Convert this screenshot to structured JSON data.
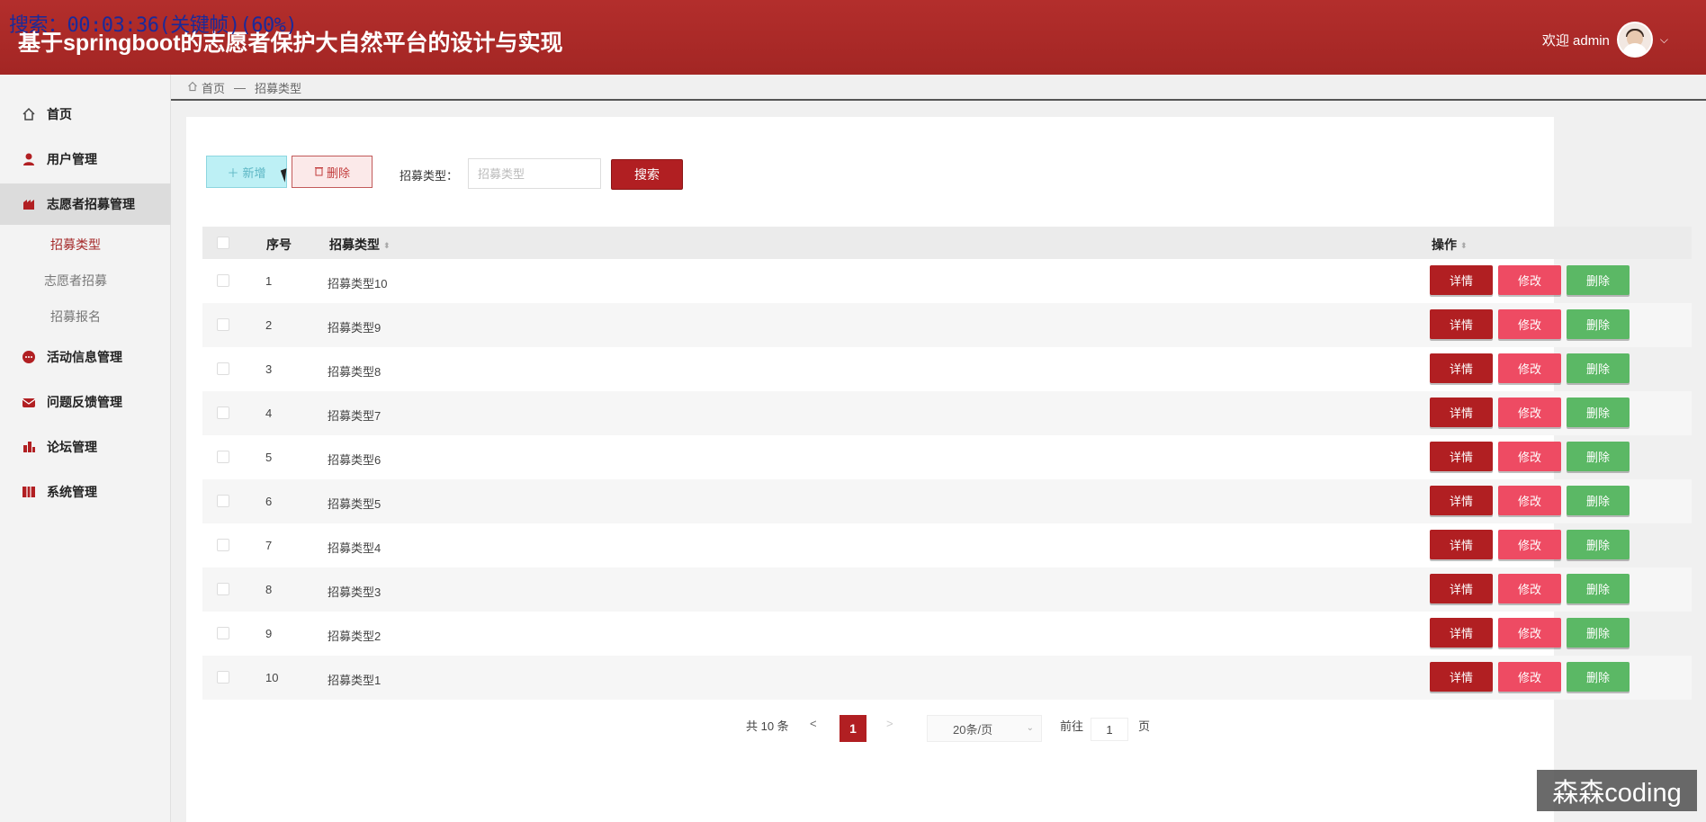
{
  "overlay": "搜索：00:03:36(关键帧)(60%)",
  "app": {
    "title": "基于springboot的志愿者保护大自然平台的设计与实现"
  },
  "user": {
    "welcome": "欢迎 admin",
    "chevron": "⌵"
  },
  "sidebar": {
    "items": [
      {
        "label": "首页",
        "icon": "home-icon"
      },
      {
        "label": "用户管理",
        "icon": "user-icon"
      },
      {
        "label": "志愿者招募管理",
        "icon": "recruit-icon"
      },
      {
        "label": "活动信息管理",
        "icon": "activity-icon"
      },
      {
        "label": "问题反馈管理",
        "icon": "feedback-icon"
      },
      {
        "label": "论坛管理",
        "icon": "forum-icon"
      },
      {
        "label": "系统管理",
        "icon": "system-icon"
      }
    ],
    "subitems": [
      {
        "label": "招募类型"
      },
      {
        "label": "志愿者招募"
      },
      {
        "label": "招募报名"
      }
    ]
  },
  "breadcrumb": {
    "home": "首页",
    "sep": "—",
    "current": "招募类型"
  },
  "toolbar": {
    "add_label": "新增",
    "delete_label": "删除",
    "search_label": "招募类型：",
    "search_placeholder": "招募类型",
    "search_button": "搜索"
  },
  "table": {
    "headers": {
      "index": "序号",
      "type": "招募类型",
      "actions": "操作"
    },
    "rows": [
      {
        "index": "1",
        "type": "招募类型10"
      },
      {
        "index": "2",
        "type": "招募类型9"
      },
      {
        "index": "3",
        "type": "招募类型8"
      },
      {
        "index": "4",
        "type": "招募类型7"
      },
      {
        "index": "5",
        "type": "招募类型6"
      },
      {
        "index": "6",
        "type": "招募类型5"
      },
      {
        "index": "7",
        "type": "招募类型4"
      },
      {
        "index": "8",
        "type": "招募类型3"
      },
      {
        "index": "9",
        "type": "招募类型2"
      },
      {
        "index": "10",
        "type": "招募类型1"
      }
    ],
    "actions": {
      "detail": "详情",
      "edit": "修改",
      "delete": "删除"
    }
  },
  "pagination": {
    "total": "共 10 条",
    "prev": "<",
    "current": "1",
    "next": ">",
    "page_size": "20条/页",
    "goto_label": "前往",
    "goto_value": "1",
    "page_suffix": "页"
  },
  "watermark": "森森coding",
  "colors": {
    "primary": "#b11f22",
    "edit": "#ee4b63",
    "delete": "#5bb865",
    "add": "#bdf0f5"
  }
}
